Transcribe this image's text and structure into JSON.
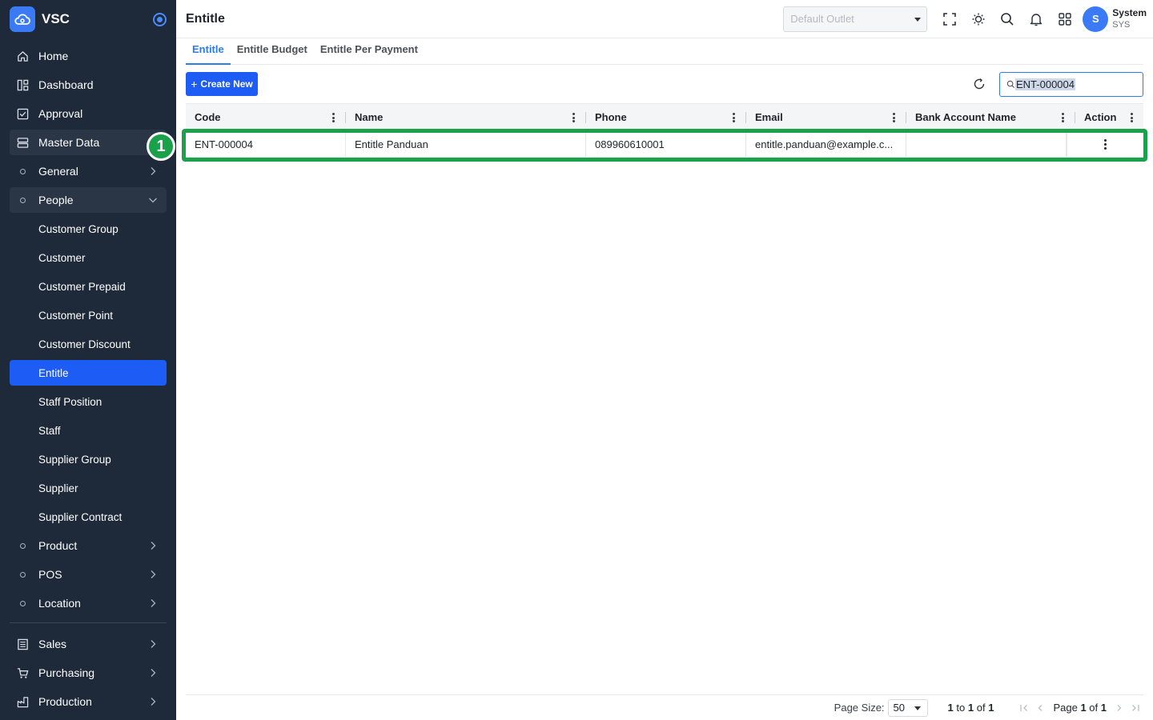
{
  "brand": {
    "name": "VSC"
  },
  "sidebar": {
    "items": [
      {
        "label": "Home",
        "icon": "home-icon"
      },
      {
        "label": "Dashboard",
        "icon": "dashboard-icon"
      },
      {
        "label": "Approval",
        "icon": "approval-icon"
      },
      {
        "label": "Master Data",
        "icon": "database-icon"
      },
      {
        "label": "General"
      },
      {
        "label": "People"
      },
      {
        "label": "Customer Group"
      },
      {
        "label": "Customer"
      },
      {
        "label": "Customer Prepaid"
      },
      {
        "label": "Customer Point"
      },
      {
        "label": "Customer Discount"
      },
      {
        "label": "Entitle"
      },
      {
        "label": "Staff Position"
      },
      {
        "label": "Staff"
      },
      {
        "label": "Supplier Group"
      },
      {
        "label": "Supplier"
      },
      {
        "label": "Supplier Contract"
      },
      {
        "label": "Product"
      },
      {
        "label": "POS"
      },
      {
        "label": "Location"
      },
      {
        "label": "Sales",
        "icon": "sales-icon"
      },
      {
        "label": "Purchasing",
        "icon": "cart-icon"
      },
      {
        "label": "Production",
        "icon": "production-icon"
      }
    ]
  },
  "annotation": {
    "step": "1"
  },
  "header": {
    "title": "Entitle",
    "outlet_placeholder": "Default Outlet",
    "user": {
      "initial": "S",
      "name": "System",
      "code": "SYS"
    }
  },
  "tabs": [
    {
      "label": "Entitle",
      "active": true
    },
    {
      "label": "Entitle Budget",
      "active": false
    },
    {
      "label": "Entitle Per Payment",
      "active": false
    }
  ],
  "toolbar": {
    "create_label": "Create New",
    "search_value": "ENT-000004"
  },
  "table": {
    "columns": [
      "Code",
      "Name",
      "Phone",
      "Email",
      "Bank Account Name",
      "Action"
    ],
    "rows": [
      {
        "code": "ENT-000004",
        "name": "Entitle Panduan",
        "phone": "089960610001",
        "email": "entitle.panduan@example.c...",
        "bank_account_name": ""
      }
    ]
  },
  "footer": {
    "page_size_label": "Page Size:",
    "page_size": "50",
    "range_from": "1",
    "range_to_label": "to",
    "range_to": "1",
    "range_of_label": "of",
    "range_total": "1",
    "page_label": "Page",
    "page_current": "1",
    "page_of_label": "of",
    "page_total": "1"
  },
  "colors": {
    "sidebar_bg": "#1e2939",
    "accent": "#1d5cf5",
    "tab_active": "#2b7de9",
    "highlight": "#1aa24a"
  }
}
